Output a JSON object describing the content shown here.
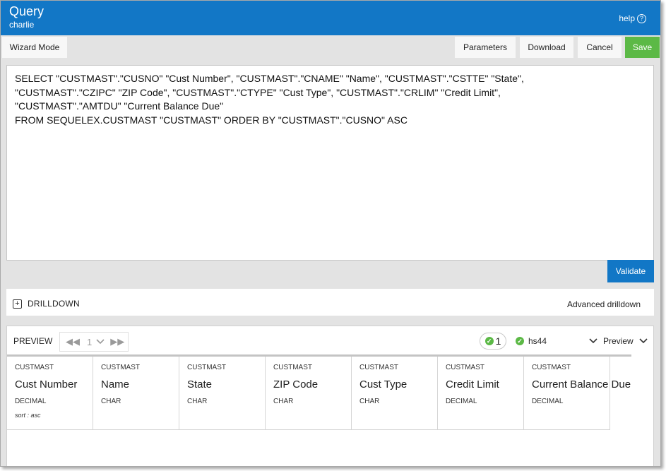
{
  "header": {
    "title": "Query",
    "subtitle": "charlie",
    "help_label": "help",
    "help_icon": "?"
  },
  "toolbar": {
    "wizard_label": "Wizard Mode",
    "parameters_label": "Parameters",
    "download_label": "Download",
    "cancel_label": "Cancel",
    "save_label": "Save"
  },
  "editor": {
    "sql": "SELECT \"CUSTMAST\".\"CUSNO\" \"Cust Number\", \"CUSTMAST\".\"CNAME\" \"Name\", \"CUSTMAST\".\"CSTTE\" \"State\",\n\"CUSTMAST\".\"CZIPC\" \"ZIP Code\", \"CUSTMAST\".\"CTYPE\" \"Cust Type\", \"CUSTMAST\".\"CRLIM\" \"Credit Limit\",\n\"CUSTMAST\".\"AMTDU\" \"Current Balance Due\"\nFROM SEQUELEX.CUSTMAST \"CUSTMAST\" ORDER BY \"CUSTMAST\".\"CUSNO\" ASC",
    "validate_label": "Validate"
  },
  "drilldown": {
    "label": "DRILLDOWN",
    "advanced_label": "Advanced drilldown"
  },
  "preview": {
    "label": "PREVIEW",
    "page": "1",
    "status_count": "1",
    "connection": "hs44",
    "menu_label": "Preview",
    "columns": [
      {
        "table": "CUSTMAST",
        "name": "Cust Number",
        "type": "DECIMAL",
        "sort": "sort : asc"
      },
      {
        "table": "CUSTMAST",
        "name": "Name",
        "type": "CHAR",
        "sort": ""
      },
      {
        "table": "CUSTMAST",
        "name": "State",
        "type": "CHAR",
        "sort": ""
      },
      {
        "table": "CUSTMAST",
        "name": "ZIP Code",
        "type": "CHAR",
        "sort": ""
      },
      {
        "table": "CUSTMAST",
        "name": "Cust Type",
        "type": "CHAR",
        "sort": ""
      },
      {
        "table": "CUSTMAST",
        "name": "Credit Limit",
        "type": "DECIMAL",
        "sort": ""
      },
      {
        "table": "CUSTMAST",
        "name": "Current Balance Due",
        "type": "DECIMAL",
        "sort": ""
      }
    ]
  },
  "colors": {
    "header_blue": "#1277c6",
    "save_green": "#5cb946",
    "status_green": "#5cb946"
  },
  "icons": {
    "help": "help-circle-icon",
    "drilldown_toggle": "plus-box-icon",
    "pager_first": "double-chevron-left-icon",
    "pager_last": "double-chevron-right-icon",
    "page_select": "chevron-down-icon",
    "status_ok": "check-circle-icon",
    "preview_menu": "chevron-down-icon"
  }
}
